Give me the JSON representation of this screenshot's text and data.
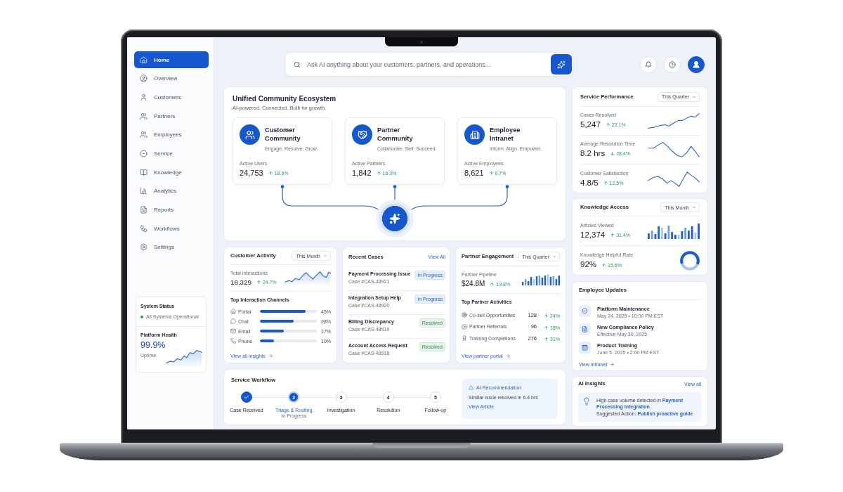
{
  "sidebar": {
    "items": [
      {
        "kind": "home",
        "label": "Home",
        "selected": true
      },
      {
        "kind": "overview",
        "label": "Overview",
        "selected": false
      },
      {
        "kind": "customers",
        "label": "Customers",
        "selected": false
      },
      {
        "kind": "partners",
        "label": "Partners",
        "selected": false
      },
      {
        "kind": "employees",
        "label": "Employees",
        "selected": false
      },
      {
        "kind": "service",
        "label": "Service",
        "selected": false
      },
      {
        "kind": "knowledge",
        "label": "Knowledge",
        "selected": false
      },
      {
        "kind": "analytics",
        "label": "Analytics",
        "selected": false
      },
      {
        "kind": "reports",
        "label": "Reports",
        "selected": false
      },
      {
        "kind": "workflows",
        "label": "Workflows",
        "selected": false
      },
      {
        "kind": "settings",
        "label": "Settings",
        "selected": false
      }
    ],
    "system_status": {
      "title": "System Status",
      "status": "All Systems Operational",
      "health_title": "Platform Health",
      "health_value": "99.9%",
      "health_label": "Uptime"
    }
  },
  "search": {
    "placeholder": "Ask AI anything about your customers, partners, and operations..."
  },
  "ecosystem": {
    "title": "Unified Community Ecosystem",
    "subtitle": "AI-powered. Connected. Built for growth.",
    "communities": [
      {
        "kind": "customer",
        "name": "Customer Community",
        "tagline": "Engage. Resolve. Grow.",
        "metric_label": "Active Users",
        "value": "24,753",
        "change": "18.6%",
        "rising": true
      },
      {
        "kind": "partner",
        "name": "Partner Community",
        "tagline": "Collaborate. Sell. Succeed.",
        "metric_label": "Active Partners",
        "value": "1,842",
        "change": "16.3%",
        "rising": true
      },
      {
        "kind": "employee",
        "name": "Employee Intranet",
        "tagline": "Inform. Align. Empower.",
        "metric_label": "Active Employees",
        "value": "8,621",
        "change": "9.7%",
        "rising": true
      }
    ]
  },
  "service_performance": {
    "title": "Service Performance",
    "period": "This Quarter",
    "metrics": [
      {
        "label": "Cases Resolved",
        "value": "5,247",
        "change": "22.1%",
        "rising": true
      },
      {
        "label": "Average Resolution Time",
        "value": "8.2 hrs",
        "change": "28.4%",
        "rising": false
      },
      {
        "label": "Customer Satisfaction",
        "value": "4.8/5",
        "change": "12.5%",
        "rising": true
      }
    ]
  },
  "knowledge_access": {
    "title": "Knowledge Access",
    "period": "This Month",
    "metrics": [
      {
        "kind": "bars",
        "label": "Articles Viewed",
        "value": "12,374",
        "change": "31.4%",
        "rising": true
      },
      {
        "kind": "ring",
        "label": "Knowledge Helpful Rate",
        "value": "92%",
        "change": "15.6%",
        "rising": true
      }
    ]
  },
  "customer_activity": {
    "title": "Customer Activity",
    "period": "This Month",
    "metric_label": "Total Interactions",
    "value": "18,329",
    "change": "24.7%",
    "rising": true,
    "channels_title": "Top Interaction Channels",
    "channels": [
      {
        "kind": "portal",
        "name": "Portal",
        "level": 0.8,
        "reading": "45%"
      },
      {
        "kind": "chat",
        "name": "Chat",
        "level": 0.59,
        "reading": "28%"
      },
      {
        "kind": "email",
        "name": "Email",
        "level": 0.42,
        "reading": "17%"
      },
      {
        "kind": "phone",
        "name": "Phone",
        "level": 0.25,
        "reading": "10%"
      }
    ],
    "link": "View all insights"
  },
  "recent_cases": {
    "title": "Recent Cases",
    "link": "View All",
    "cases": [
      {
        "title": "Payment Processing Issue",
        "case_id": "Case #CAS-48921",
        "status": "In Progress",
        "kind": "progress"
      },
      {
        "title": "Integration Setup Help",
        "case_id": "Case #CAS-48920",
        "status": "In Progress",
        "kind": "progress"
      },
      {
        "title": "Billing Discrepancy",
        "case_id": "Case #CAS-48919",
        "status": "Resolved",
        "kind": "resolved"
      },
      {
        "title": "Account Access Request",
        "case_id": "Case #CAS-48918",
        "status": "Resolved",
        "kind": "resolved"
      }
    ]
  },
  "partner_engagement": {
    "title": "Partner Engagement",
    "period": "This Quarter",
    "metric_label": "Partner Pipeline",
    "value": "$24.8M",
    "change": "19.8%",
    "rising": true,
    "activities_title": "Top Partner Activities",
    "activities": [
      {
        "kind": "cosell",
        "name": "Co-sell Opportunities",
        "count": "128",
        "change": "24%",
        "rising": true
      },
      {
        "kind": "referral",
        "name": "Partner Referrals",
        "count": "96",
        "change": "18%",
        "rising": true
      },
      {
        "kind": "training",
        "name": "Training Completions",
        "count": "276",
        "change": "31%",
        "rising": true
      }
    ],
    "link": "View partner portal"
  },
  "employee_updates": {
    "title": "Employee Updates",
    "updates": [
      {
        "kind": "maintenance",
        "title": "Platform Maintenance",
        "detail": "May 24, 2025 • 10:00 PM EST"
      },
      {
        "kind": "policy",
        "title": "New Compliance Policy",
        "detail": "Effective May 30, 2025"
      },
      {
        "kind": "training",
        "title": "Product Training",
        "detail": "June 5, 2025 • 2:00 PM EST"
      }
    ],
    "link": "View intranet"
  },
  "service_workflow": {
    "title": "Service Workflow",
    "steps": [
      {
        "label": "Case Received",
        "completed": true,
        "selected": false
      },
      {
        "number": "2",
        "label": "Triage & Routing",
        "note": "In Progress",
        "completed": false,
        "selected": true
      },
      {
        "number": "3",
        "label": "Investigation",
        "completed": false,
        "selected": false
      },
      {
        "number": "4",
        "label": "Resolution",
        "completed": false,
        "selected": false
      },
      {
        "number": "5",
        "label": "Follow-up",
        "completed": false,
        "selected": false
      }
    ],
    "recommendation": {
      "title": "AI Recommendation",
      "text": "Similar issue resolved in 6.4 hrs",
      "link": "View Article"
    }
  },
  "ai_insights": {
    "title": "AI Insights",
    "link": "View all",
    "insight": "High case volume detected in **Payment Processing Integration**",
    "action": "Suggested Action: **Publish proactive guide**"
  }
}
